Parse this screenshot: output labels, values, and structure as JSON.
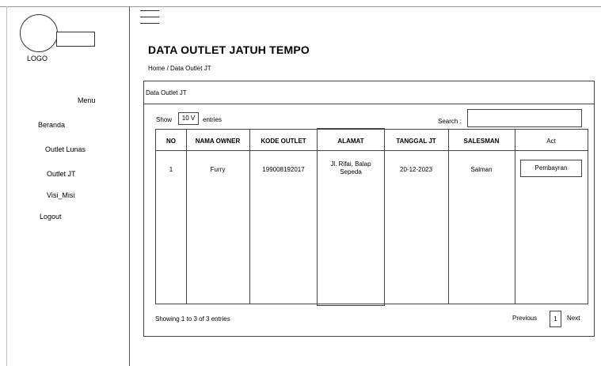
{
  "sidebar": {
    "logo_label": "LOGO",
    "menu_title": "Menu",
    "items": [
      {
        "label": "Beranda"
      },
      {
        "label": "Outlet Lunas"
      },
      {
        "label": "Outlet JT"
      },
      {
        "label": "Visi_Misi"
      },
      {
        "label": "Logout"
      }
    ]
  },
  "header": {
    "menu_icon": "hamburger-icon",
    "title": "DATA OUTLET JATUH TEMPO",
    "breadcrumb": "Home / Data Outlet JT"
  },
  "panel": {
    "title": "Data Outlet JT",
    "show_label": "Show",
    "entries_value": "10 V",
    "entries_label": "entries",
    "search_label": "Search :",
    "search_value": ""
  },
  "table": {
    "columns": [
      "NO",
      "NAMA OWNER",
      "KODE OUTLET",
      "ALAMAT",
      "TANGGAL JT",
      "SALESMAN",
      "Act"
    ],
    "rows": [
      {
        "no": "1",
        "owner": "Furry",
        "kode": "199008192017",
        "alamat_line1": "Jl. Rifai,  Balap",
        "alamat_line2": "Sepeda",
        "tanggal": "20-12-2023",
        "salesman": "Salman",
        "action": "Pembayran"
      }
    ]
  },
  "footer": {
    "info": "Showing 1 to 3 of 3 entries",
    "previous": "Previous",
    "page": "1",
    "next": "Next"
  }
}
